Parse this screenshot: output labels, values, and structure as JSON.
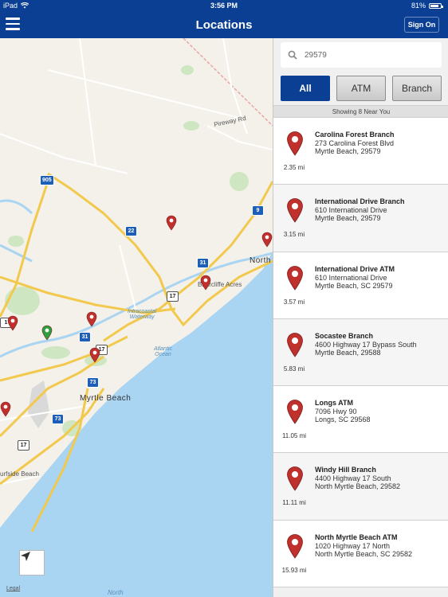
{
  "status": {
    "device": "iPad",
    "time": "3:56 PM",
    "battery": "81%",
    "battery_level": 0.81
  },
  "nav": {
    "title": "Locations",
    "signon_label": "Sign On"
  },
  "search": {
    "value": "29579",
    "placeholder": ""
  },
  "filters": {
    "all": "All",
    "atm": "ATM",
    "branch": "Branch",
    "selected": "All"
  },
  "showing_text": "Showing 8 Near You",
  "map": {
    "legal": "Legal",
    "labels": {
      "pireway_rd": "Pireway Rd",
      "north": "North",
      "briarcliffe": "Briarcliffe Acres",
      "myrtle_beach": "Myrtle Beach",
      "surfside": "urfside Beach",
      "atlantic_1": "Atlantic",
      "atlantic_2": "Ocean",
      "waterway_1": "Intracoastal",
      "waterway_2": "Waterway",
      "north_bottom": "North"
    },
    "shields": {
      "s905": "905",
      "s9": "9",
      "s22": "22",
      "s31a": "31",
      "s17a": "17",
      "s31b": "31",
      "s17b": "17",
      "s73a": "73",
      "s73b": "73",
      "s17c": "17",
      "s1": "1"
    }
  },
  "locations": [
    {
      "name": "Carolina Forest Branch",
      "address1": "273 Carolina Forest Blvd",
      "address2": "Myrtle Beach,  29579",
      "distance": "2.35 mi"
    },
    {
      "name": "International Drive Branch",
      "address1": "610 International Drive",
      "address2": "Myrtle Beach,  29579",
      "distance": "3.15 mi"
    },
    {
      "name": "International Drive ATM",
      "address1": "610 International Drive",
      "address2": "Myrtle Beach, SC 29579",
      "distance": "3.57 mi"
    },
    {
      "name": "Socastee Branch",
      "address1": "4600 Highway 17 Bypass South",
      "address2": "Myrtle Beach,  29588",
      "distance": "5.83 mi"
    },
    {
      "name": "Longs ATM",
      "address1": "7096 Hwy 90",
      "address2": "Longs, SC 29568",
      "distance": "11.05 mi"
    },
    {
      "name": "Windy Hill Branch",
      "address1": "4400 Highway 17 South",
      "address2": "North Myrtle Beach,  29582",
      "distance": "11.11 mi"
    },
    {
      "name": "North Myrtle Beach ATM",
      "address1": "1020 Highway 17 North",
      "address2": "North Myrtle Beach, SC 29582",
      "distance": "15.93 mi"
    }
  ],
  "colors": {
    "brand": "#0a3f94",
    "pin": "#c0302d",
    "pin_current": "#2e9e40",
    "ocean": "#a9d4f2",
    "land": "#f3f1ea",
    "road": "#f2c94c"
  }
}
